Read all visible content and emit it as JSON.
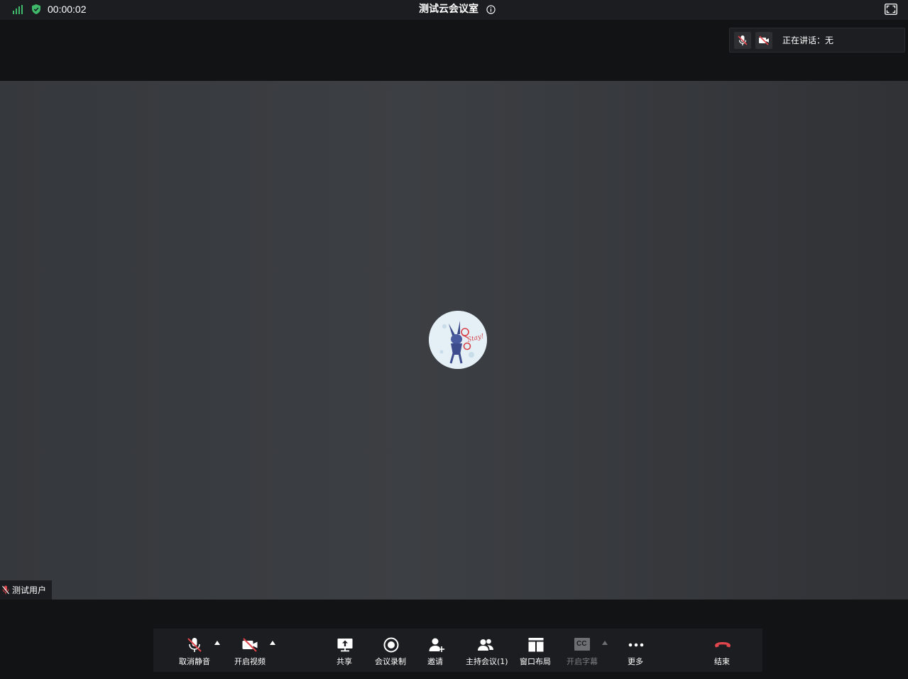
{
  "topbar": {
    "timer": "00:00:02",
    "title": "测试云会议室",
    "icons": [
      "signal-icon",
      "shield-check-icon",
      "info-icon",
      "fullscreen-icon"
    ],
    "signal_color": "#3fba6b",
    "shield_color": "#3fba6b"
  },
  "speaking_panel": {
    "label": "正在讲话：",
    "value": "无",
    "icons": [
      "mic-muted-icon",
      "camera-off-icon"
    ]
  },
  "video": {
    "participant_name": "测试用户",
    "avatar_text": "Stay!",
    "muted_color": "#e0464b"
  },
  "toolbar": {
    "mute": "取消静音",
    "video": "开启视频",
    "share": "共享",
    "record": "会议录制",
    "invite": "邀请",
    "host": "主持会议(1)",
    "layout": "窗口布局",
    "captions": "开启字幕",
    "captions_icon_text": "CC",
    "more": "更多",
    "end": "结束",
    "end_color": "#e0464b"
  }
}
